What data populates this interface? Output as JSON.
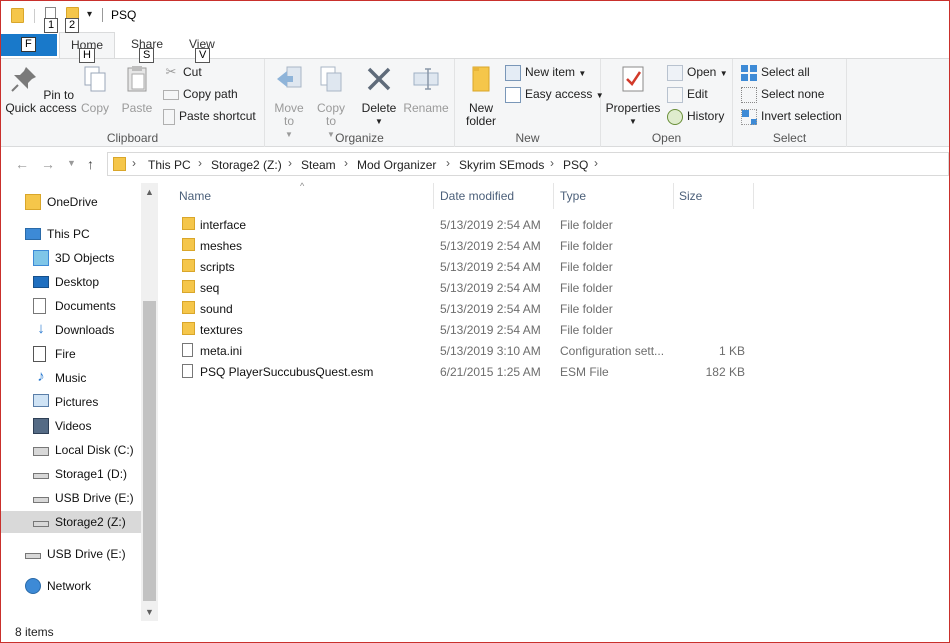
{
  "window": {
    "title": "PSQ"
  },
  "quick_access_keytips": [
    "1",
    "2"
  ],
  "tabs": {
    "file_key": "F",
    "home": "Home",
    "home_key": "H",
    "share": "Share",
    "share_key": "S",
    "view": "View",
    "view_key": "V"
  },
  "ribbon": {
    "clipboard": {
      "label": "Clipboard",
      "pin": "Pin to Quick access",
      "copy": "Copy",
      "paste": "Paste",
      "cut": "Cut",
      "copy_path": "Copy path",
      "paste_shortcut": "Paste shortcut"
    },
    "organize": {
      "label": "Organize",
      "move_to": "Move to",
      "copy_to": "Copy to",
      "delete": "Delete",
      "rename": "Rename"
    },
    "new": {
      "label": "New",
      "new_folder": "New folder",
      "new_item": "New item",
      "easy_access": "Easy access"
    },
    "open": {
      "label": "Open",
      "properties": "Properties",
      "open": "Open",
      "edit": "Edit",
      "history": "History"
    },
    "select": {
      "label": "Select",
      "select_all": "Select all",
      "select_none": "Select none",
      "invert_selection": "Invert selection"
    }
  },
  "address": {
    "crumbs": [
      "This PC",
      "Storage2 (Z:)",
      "Steam",
      "Mod Organizer",
      "Skyrim SEmods",
      "PSQ"
    ]
  },
  "nav": {
    "items": [
      {
        "label": "OneDrive",
        "icon": "folder-icon"
      },
      {
        "label": "This PC",
        "icon": "computer-icon"
      },
      {
        "label": "3D Objects",
        "icon": "cube-icon"
      },
      {
        "label": "Desktop",
        "icon": "desktop-icon"
      },
      {
        "label": "Documents",
        "icon": "documents-icon"
      },
      {
        "label": "Downloads",
        "icon": "download-icon"
      },
      {
        "label": "Fire",
        "icon": "fire-icon"
      },
      {
        "label": "Music",
        "icon": "music-icon"
      },
      {
        "label": "Pictures",
        "icon": "pictures-icon"
      },
      {
        "label": "Videos",
        "icon": "videos-icon"
      },
      {
        "label": "Local Disk (C:)",
        "icon": "windows-drive-icon"
      },
      {
        "label": "Storage1 (D:)",
        "icon": "drive-icon"
      },
      {
        "label": "USB Drive (E:)",
        "icon": "drive-icon"
      },
      {
        "label": "Storage2 (Z:)",
        "icon": "drive-icon"
      },
      {
        "label": "USB Drive (E:)",
        "icon": "drive-icon"
      },
      {
        "label": "Network",
        "icon": "network-icon"
      }
    ]
  },
  "columns": {
    "name": "Name",
    "date": "Date modified",
    "type": "Type",
    "size": "Size"
  },
  "files": [
    {
      "name": "interface",
      "date": "5/13/2019 2:54 AM",
      "type": "File folder",
      "size": "",
      "icon": "folder-icon"
    },
    {
      "name": "meshes",
      "date": "5/13/2019 2:54 AM",
      "type": "File folder",
      "size": "",
      "icon": "folder-icon"
    },
    {
      "name": "scripts",
      "date": "5/13/2019 2:54 AM",
      "type": "File folder",
      "size": "",
      "icon": "folder-icon"
    },
    {
      "name": "seq",
      "date": "5/13/2019 2:54 AM",
      "type": "File folder",
      "size": "",
      "icon": "folder-icon"
    },
    {
      "name": "sound",
      "date": "5/13/2019 2:54 AM",
      "type": "File folder",
      "size": "",
      "icon": "folder-icon"
    },
    {
      "name": "textures",
      "date": "5/13/2019 2:54 AM",
      "type": "File folder",
      "size": "",
      "icon": "folder-icon"
    },
    {
      "name": "meta.ini",
      "date": "5/13/2019 3:10 AM",
      "type": "Configuration sett...",
      "size": "1 KB",
      "icon": "config-file-icon"
    },
    {
      "name": "PSQ PlayerSuccubusQuest.esm",
      "date": "6/21/2015 1:25 AM",
      "type": "ESM File",
      "size": "182 KB",
      "icon": "file-icon"
    }
  ],
  "status": {
    "count": "8 items"
  },
  "colors": {
    "file_tab": "#1979ca",
    "folder": "#f5c64a",
    "selected_nav": "#d9d9d9"
  }
}
